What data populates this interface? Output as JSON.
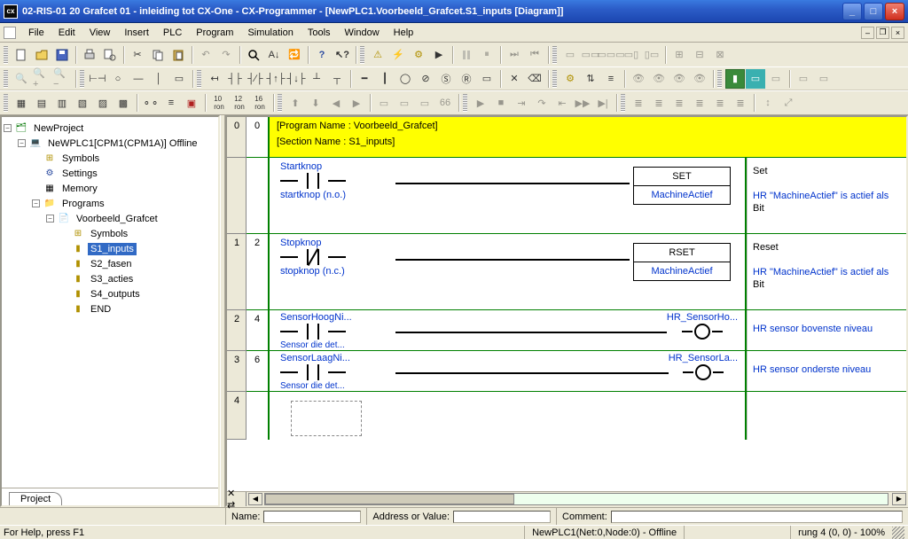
{
  "window": {
    "title": "02-RIS-01 20 Grafcet 01 - inleiding tot CX-One - CX-Programmer - [NewPLC1.Voorbeeld_Grafcet.S1_inputs [Diagram]]"
  },
  "menu": {
    "file": "File",
    "edit": "Edit",
    "view": "View",
    "insert": "Insert",
    "plc": "PLC",
    "program": "Program",
    "simulation": "Simulation",
    "tools": "Tools",
    "window": "Window",
    "help": "Help"
  },
  "sidebar": {
    "tab": "Project",
    "root": "NewProject",
    "plc": "NeWPLC1[CPM1(CPM1A)] Offline",
    "symbols": "Symbols",
    "settings": "Settings",
    "memory": "Memory",
    "programs": "Programs",
    "program1": "Voorbeeld_Grafcet",
    "p_symbols": "Symbols",
    "sections": [
      "S1_inputs",
      "S2_fasen",
      "S3_acties",
      "S4_outputs"
    ],
    "end": "END",
    "selected": "S1_inputs"
  },
  "banner": {
    "program": "[Program Name : Voorbeeld_Grafcet]",
    "section": "[Section Name : S1_inputs]"
  },
  "rungs": [
    {
      "num": "0",
      "addr": "0",
      "in_name": "Startknop",
      "in_desc": "startknop (n.o.)",
      "in_type": "no",
      "out_head": "SET",
      "out_body": "MachineActief",
      "cmt_title": "Set",
      "cmt_line1": "HR \"MachineActief\" is actief als",
      "cmt_line2": "Bit"
    },
    {
      "num": "1",
      "addr": "2",
      "in_name": "Stopknop",
      "in_desc": "stopknop (n.c.)",
      "in_type": "nc",
      "out_head": "RSET",
      "out_body": "MachineActief",
      "cmt_title": "Reset",
      "cmt_line1": "HR \"MachineActief\" is actief als",
      "cmt_line2": "Bit"
    },
    {
      "num": "2",
      "addr": "4",
      "in_name": "SensorHoogNi...",
      "in_desc": "Sensor die det...",
      "in_type": "no",
      "coil_name": "HR_SensorHo...",
      "cmt_title": "",
      "cmt_line1": "HR sensor bovenste niveau",
      "cmt_line2": ""
    },
    {
      "num": "3",
      "addr": "6",
      "in_name": "SensorLaagNi...",
      "in_desc": "Sensor die det...",
      "in_type": "no",
      "coil_name": "HR_SensorLa...",
      "cmt_title": "",
      "cmt_line1": "HR sensor onderste niveau",
      "cmt_line2": ""
    },
    {
      "num": "4",
      "addr": "",
      "empty": true
    }
  ],
  "infobar": {
    "name": "Name:",
    "addr": "Address or Value:",
    "comment": "Comment:"
  },
  "statusbar": {
    "help": "For Help, press F1",
    "conn": "NewPLC1(Net:0,Node:0) - Offline",
    "rung": "rung 4 (0, 0)  - 100%"
  }
}
